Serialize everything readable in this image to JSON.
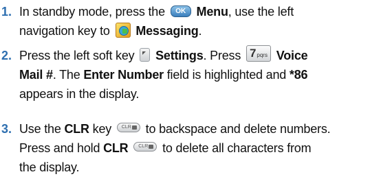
{
  "steps": [
    {
      "number": "1.",
      "lines": [
        {
          "t1": "In standby mode, press the ",
          "key": "OK",
          "t2": "Menu",
          "t3": ", use the left"
        },
        {
          "t1": "navigation key to ",
          "t2": "Messaging",
          "t3": "."
        }
      ]
    },
    {
      "number": "2.",
      "lines": [
        {
          "t1": "Press the left soft key ",
          "t2": "Settings",
          "t3": ". Press ",
          "key_digit": "7",
          "key_letters": "pqrs",
          "t4": "Voice"
        },
        {
          "t1": "Mail #",
          "t2": ". The ",
          "t3": "Enter Number",
          "t4": " field is highlighted and ",
          "t5": "*86"
        },
        {
          "t1": "appears in the display."
        }
      ]
    },
    {
      "number": "3.",
      "lines": [
        {
          "t1": "Use the ",
          "t2": "CLR",
          "t3": " key ",
          "key": "CLR",
          "t4": " to backspace and delete numbers."
        },
        {
          "t1": "Press and hold ",
          "t2": "CLR",
          "key": "CLR",
          "t3": " to delete all characters from"
        },
        {
          "t1": "the display."
        }
      ]
    }
  ],
  "icons": {
    "ok_key": "ok-key-icon",
    "messaging": "messaging-icon",
    "left_soft_key": "left-soft-key-icon",
    "seven_key": "seven-pqrs-key-icon",
    "clr_key": "clr-key-icon"
  },
  "colors": {
    "step_number": "#2e6fb0",
    "text": "#111111",
    "ok_key": "#3b7fbd"
  }
}
